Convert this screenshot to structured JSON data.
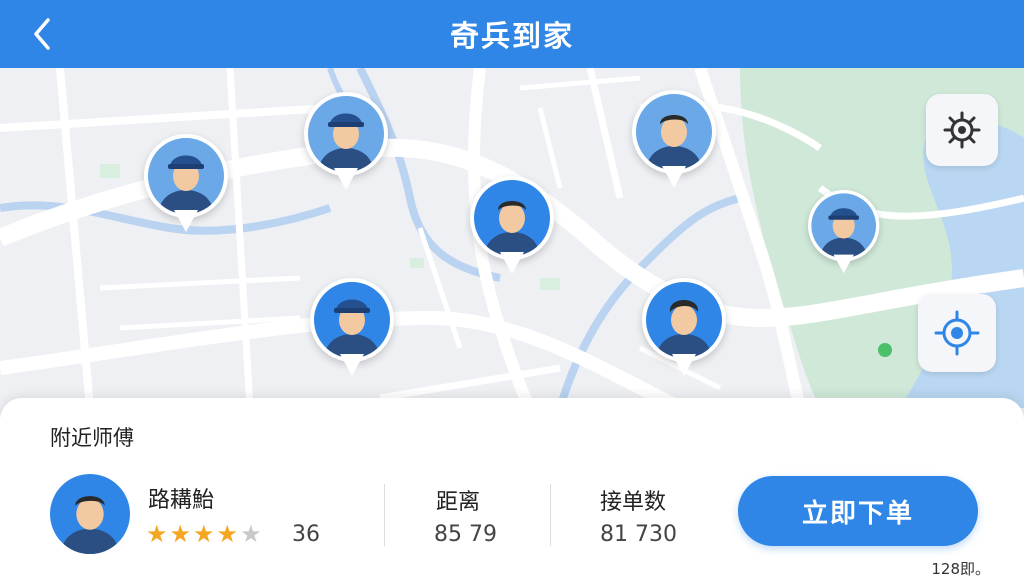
{
  "header": {
    "title": "奇兵到家",
    "back_icon": "chevron-left-icon"
  },
  "map": {
    "controls": [
      {
        "icon": "gear-icon"
      },
      {
        "icon": "locate-crosshair-icon"
      }
    ],
    "pins": [
      {
        "name": "pin-worker-1",
        "bg": "#6aa8e8"
      },
      {
        "name": "pin-worker-2",
        "bg": "#6aa8e8"
      },
      {
        "name": "pin-worker-3",
        "bg": "#6aa8e8"
      },
      {
        "name": "pin-worker-4",
        "bg": "#2f86e6"
      },
      {
        "name": "pin-worker-5",
        "bg": "#2f86e6"
      },
      {
        "name": "pin-worker-6",
        "bg": "#2f86e6"
      },
      {
        "name": "pin-worker-7",
        "bg": "#6aa8e8"
      }
    ]
  },
  "panel": {
    "title": "附近师傅",
    "worker": {
      "name": "路耩鮐",
      "rating_stars": 4,
      "rating_count": "36"
    },
    "distance": {
      "label": "距离",
      "value": "85 79"
    },
    "orders": {
      "label": "接单数",
      "value": "81 730"
    },
    "order_button": "立即下单",
    "corner_text": "128即。"
  },
  "colors": {
    "accent": "#2f86e6",
    "star": "#f5a623",
    "star_empty": "#c8c8c8"
  }
}
